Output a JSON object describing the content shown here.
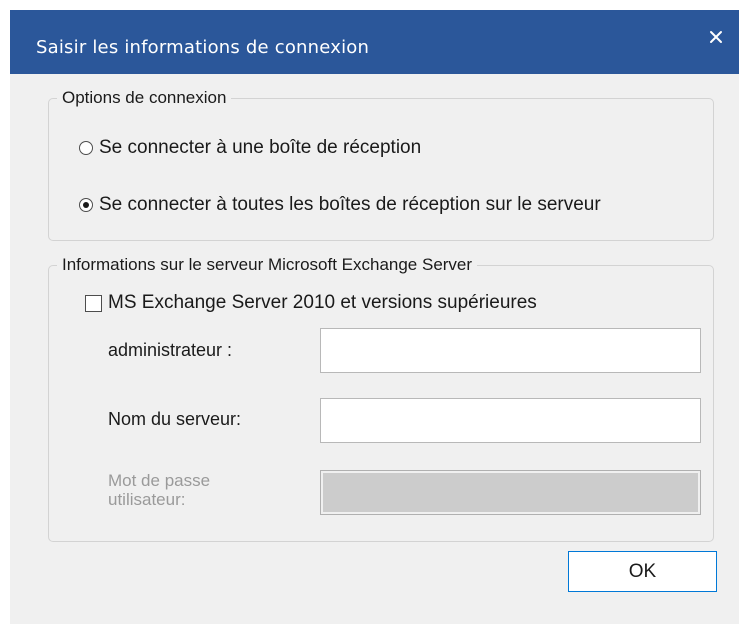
{
  "dialog": {
    "title": "Saisir les informations de connexion",
    "close_icon": "close-icon",
    "accent_color": "#2b579a"
  },
  "connection_options": {
    "legend": "Options de connexion",
    "options": [
      {
        "label": "Se connecter à une boîte de réception",
        "selected": false
      },
      {
        "label": "Se connecter à toutes les boîtes de réception sur le serveur",
        "selected": true
      }
    ]
  },
  "exchange_info": {
    "legend": "Informations sur le serveur Microsoft Exchange Server",
    "checkbox_label": "MS Exchange Server 2010 et versions supérieures",
    "checkbox_checked": false,
    "admin_label": "administrateur :",
    "admin_value": "",
    "server_label": "Nom du serveur:",
    "server_value": "",
    "password_label": "Mot de passe utilisateur:",
    "password_value": "",
    "password_enabled": false
  },
  "footer": {
    "ok_label": "OK"
  }
}
